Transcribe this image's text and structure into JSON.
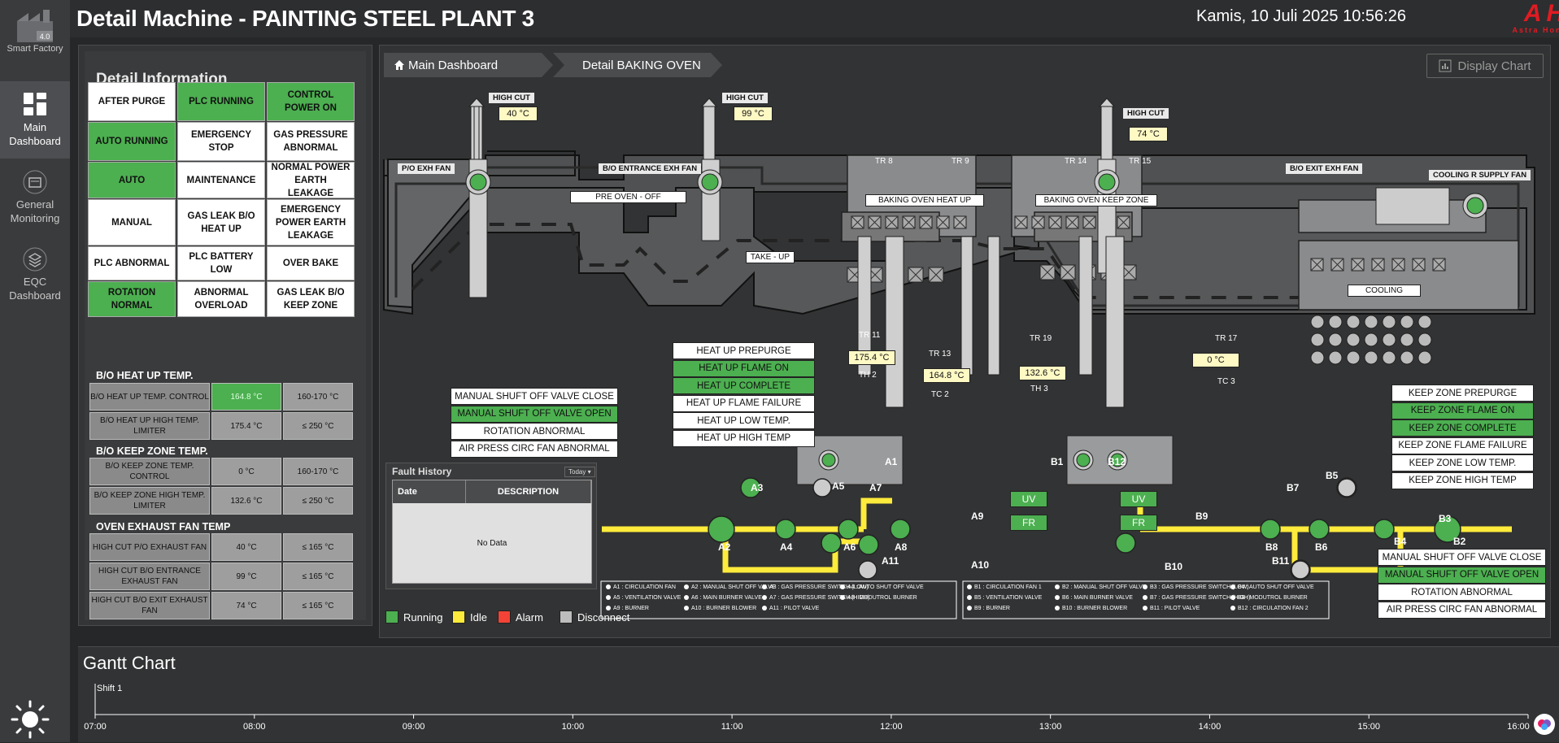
{
  "app": {
    "logo_text": "4.0",
    "logo_label": "Smart Factory"
  },
  "sidebar": {
    "items": [
      {
        "label": "Main\nDashboard",
        "icon": "grid-icon",
        "active": true
      },
      {
        "label": "General\nMonitoring",
        "icon": "folder-icon",
        "active": false
      },
      {
        "label": "EQC\nDashboard",
        "icon": "layers-icon",
        "active": false
      }
    ]
  },
  "header": {
    "title": "Detail Machine - PAINTING STEEL PLANT 3",
    "datetime": "Kamis, 10 Juli 2025 10:56:26",
    "brand": "AHM",
    "brand_sub": "Astra Honda Motor"
  },
  "info": {
    "title": "Detail Information",
    "status_grid": [
      [
        "AFTER PURGE",
        "PLC RUNNING",
        "CONTROL POWER ON"
      ],
      [
        "AUTO RUNNING",
        "EMERGENCY STOP",
        "GAS PRESSURE ABNORMAL"
      ],
      [
        "AUTO",
        "MAINTENANCE",
        "NORMAL POWER EARTH LEAKAGE"
      ],
      [
        "MANUAL",
        "GAS LEAK B/O HEAT UP",
        "EMERGENCY POWER EARTH LEAKAGE"
      ],
      [
        "PLC ABNORMAL",
        "PLC BATTERY LOW",
        "OVER BAKE"
      ],
      [
        "ROTATION NORMAL",
        "ABNORMAL OVERLOAD",
        "GAS LEAK B/O KEEP ZONE"
      ]
    ],
    "heat_up": {
      "title": "B/O HEAT UP TEMP.",
      "rows": [
        {
          "label": "B/O HEAT UP TEMP. CONTROL",
          "value": "164.8 °C",
          "limit": "160-170 °C"
        },
        {
          "label": "B/O HEAT UP HIGH TEMP. LIMITER",
          "value": "175.4 °C",
          "limit": "≤ 250 °C"
        }
      ]
    },
    "keep_zone": {
      "title": "B/O KEEP ZONE TEMP.",
      "rows": [
        {
          "label": "B/O KEEP ZONE TEMP. CONTROL",
          "value": "0 °C",
          "limit": "160-170 °C"
        },
        {
          "label": "B/O KEEP ZONE HIGH TEMP. LIMITER",
          "value": "132.6 °C",
          "limit": "≤ 250 °C"
        }
      ]
    },
    "exhaust": {
      "title": "OVEN EXHAUST FAN TEMP",
      "rows": [
        {
          "label": "HIGH CUT P/O EXHAUST FAN",
          "value": "40 °C",
          "limit": "≤ 165 °C"
        },
        {
          "label": "HIGH CUT B/O ENTRANCE EXHAUST FAN",
          "value": "99 °C",
          "limit": "≤ 165 °C"
        },
        {
          "label": "HIGH CUT B/O EXIT EXHAUST FAN",
          "value": "74 °C",
          "limit": "≤ 165 °C"
        }
      ]
    }
  },
  "breadcrumb": {
    "home": "Main Dashboard",
    "current": "Detail BAKING OVEN"
  },
  "display_chart": "Display Chart",
  "diagram": {
    "high_cut": "HIGH CUT",
    "temps": {
      "hc1": "40 °C",
      "hc2": "99 °C",
      "hc3": "74 °C",
      "tr11": "175.4 °C",
      "th2": "164.8 °C",
      "tr19": "132.6 °C",
      "tr17": "0 °C"
    },
    "labels": {
      "po_exh": "P/O EXH FAN",
      "bo_entrance": "B/O ENTRANCE EXH FAN",
      "bo_exit": "B/O EXIT EXH FAN",
      "cooling_fan": "COOLING R SUPPLY FAN",
      "pre_oven": "PRE OVEN - OFF",
      "take_up": "TAKE - UP",
      "heat_up": "BAKING OVEN HEAT UP",
      "keep_zone": "BAKING OVEN KEEP ZONE",
      "cooling": "COOLING",
      "tr8": "TR 8",
      "tr9": "TR 9",
      "tr14": "TR 14",
      "tr15": "TR 15",
      "tr11": "TR 11",
      "tr13": "TR 13",
      "th2": "TH 2",
      "tc2": "TC 2",
      "tr19": "TR 19",
      "th3": "TH 3",
      "tr17": "TR 17",
      "tc3": "TC 3"
    },
    "heat_up_signals": [
      {
        "label": "HEAT UP PREPURGE",
        "on": false
      },
      {
        "label": "HEAT UP FLAME ON",
        "on": true
      },
      {
        "label": "HEAT UP COMPLETE",
        "on": true
      },
      {
        "label": "HEAT UP FLAME FAILURE",
        "on": false
      },
      {
        "label": "HEAT UP LOW TEMP.",
        "on": false
      },
      {
        "label": "HEAT UP HIGH TEMP",
        "on": false
      }
    ],
    "keep_signals": [
      {
        "label": "KEEP ZONE PREPURGE",
        "on": false
      },
      {
        "label": "KEEP ZONE FLAME ON",
        "on": true
      },
      {
        "label": "KEEP ZONE COMPLETE",
        "on": true
      },
      {
        "label": "KEEP ZONE FLAME FAILURE",
        "on": false
      },
      {
        "label": "KEEP ZONE LOW TEMP.",
        "on": false
      },
      {
        "label": "KEEP ZONE HIGH TEMP",
        "on": false
      }
    ],
    "left_valve_signals": [
      {
        "label": "MANUAL SHUFT OFF VALVE CLOSE",
        "on": false
      },
      {
        "label": "MANUAL SHUFT OFF VALVE OPEN",
        "on": true
      },
      {
        "label": "ROTATION ABNORMAL",
        "on": false
      },
      {
        "label": "AIR PRESS CIRC FAN ABNORMAL",
        "on": false
      }
    ],
    "right_valve_signals": [
      {
        "label": "MANUAL SHUFT OFF VALVE CLOSE",
        "on": false
      },
      {
        "label": "MANUAL SHUFT OFF VALVE OPEN",
        "on": true
      },
      {
        "label": "ROTATION ABNORMAL",
        "on": false
      },
      {
        "label": "AIR PRESS CIRC FAN ABNORMAL",
        "on": false
      }
    ],
    "valves": {
      "a1": "A1",
      "a2": "A2",
      "a3": "A3",
      "a4": "A4",
      "a5": "A5",
      "a6": "A6",
      "a7": "A7",
      "a8": "A8",
      "a9": "A9",
      "a10": "A10",
      "a11": "A11",
      "b1": "B1",
      "b2": "B2",
      "b3": "B3",
      "b4": "B4",
      "b5": "B5",
      "b6": "B6",
      "b7": "B7",
      "b8": "B8",
      "b9": "B9",
      "b10": "B10",
      "b11": "B11",
      "b12": "B12"
    },
    "uv": "UV",
    "fr": "FR",
    "legend_a": [
      "A1 : CIRCULATION FAN",
      "A2 : MANUAL SHUT OFF VALVE",
      "A3 : GAS PRESSURE SWITCH (LOW)",
      "A4 : AUTO SHUT OFF VALVE",
      "A5 : VENTILATION VALVE",
      "A6 : MAIN BURNER VALVE",
      "A7 : GAS PRESSURE SWITCH (HIGH)",
      "A8 : MODUTROL BURNER",
      "A9 : BURNER",
      "A10 : BURNER BLOWER",
      "A11 : PILOT VALVE"
    ],
    "legend_b": [
      "B1 : CIRCULATION FAN 1",
      "B2 : MANUAL SHUT OFF VALVE",
      "B3 : GAS PRESSURE SWITCH (LOW)",
      "B4 : AUTO SHUT OFF VALVE",
      "B5 : VENTILATION VALVE",
      "B6 : MAIN BURNER VALVE",
      "B7 : GAS PRESSURE SWITCH (HIGH)",
      "B8 : MODUTROL BURNER",
      "B9 : BURNER",
      "B10 : BURNER BLOWER",
      "B11 : PILOT VALVE",
      "B12 : CIRCULATION FAN 2"
    ]
  },
  "fault": {
    "title": "Fault History",
    "filter": "Today",
    "col_date": "Date",
    "col_desc": "DESCRIPTION",
    "empty": "No Data"
  },
  "status_legend": [
    {
      "label": "Running",
      "color": "#4caf50"
    },
    {
      "label": "Idle",
      "color": "#ffeb3b"
    },
    {
      "label": "Alarm",
      "color": "#f44336"
    },
    {
      "label": "Disconnect",
      "color": "#bdbdbd"
    }
  ],
  "gantt": {
    "title": "Gantt Chart",
    "shift": "Shift 1",
    "ticks": [
      "07:00",
      "08:00",
      "09:00",
      "10:00",
      "11:00",
      "12:00",
      "13:00",
      "14:00",
      "15:00",
      "16:00"
    ]
  },
  "colors": {
    "running": "#4caf50",
    "pipe_yellow": "#ffeb3b",
    "brand": "#e11b22"
  }
}
